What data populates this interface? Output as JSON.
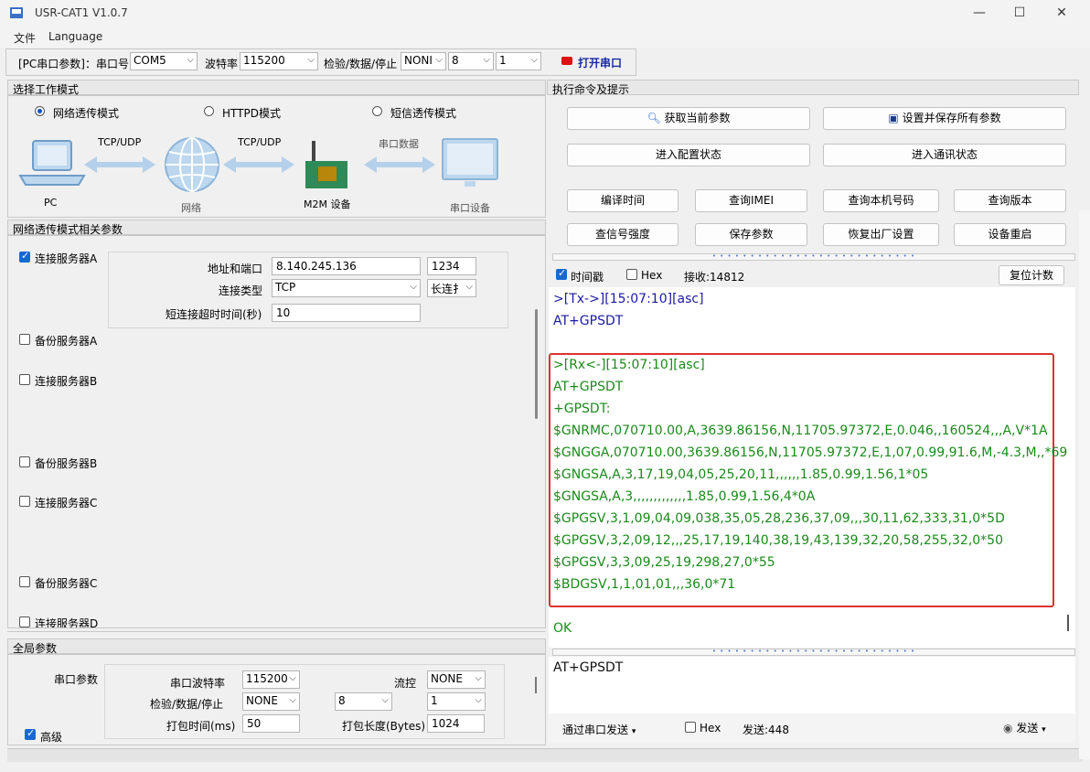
{
  "window": {
    "title": "USR-CAT1 V1.0.7",
    "min": "—",
    "max": "☐",
    "close": "✕"
  },
  "menu": {
    "file": "文件",
    "language": "Language"
  },
  "toolbar": {
    "pc_params": "[PC串口参数]：串口号",
    "port": "COM5",
    "baud_label": "波特率",
    "baud": "115200",
    "parity_label": "检验/数据/停止",
    "parity": "NONI",
    "data_bits": "8",
    "stop_bits": "1",
    "open_port": "打开串口"
  },
  "left": {
    "mode_header": "选择工作模式",
    "modes": [
      "网络透传模式",
      "HTTPD模式",
      "短信透传模式"
    ],
    "diagram": {
      "pc": "PC",
      "tcp1": "TCP/UDP",
      "network": "网络",
      "tcp2": "TCP/UDP",
      "m2m": "M2M 设备",
      "serial_data": "串口数据",
      "serial_device": "串口设备"
    },
    "params_header": "网络透传模式相关参数",
    "server_a": "连接服务器A",
    "addr_label": "地址和端口",
    "addr": "8.140.245.136",
    "port": "1234",
    "conn_type_label": "连接类型",
    "conn_type": "TCP",
    "long_conn": "长连扌",
    "timeout_label": "短连接超时时间(秒)",
    "timeout": "10",
    "backup_a": "备份服务器A",
    "server_b": "连接服务器B",
    "backup_b": "备份服务器B",
    "server_c": "连接服务器C",
    "backup_c": "备份服务器C",
    "server_d": "连接服务器D",
    "global_header": "全局参数",
    "serial_params": "串口参数",
    "baud_label": "串口波特率",
    "baud": "115200",
    "flow_label": "流控",
    "flow": "NONE",
    "parity_label": "检验/数据/停止",
    "parity": "NONE",
    "data_bits": "8",
    "stop_bits": "1",
    "pack_time_label": "打包时间(ms)",
    "pack_time": "50",
    "pack_len_label": "打包长度(Bytes)",
    "pack_len": "1024",
    "advanced": "高级"
  },
  "right": {
    "header": "执行命令及提示",
    "get_params": "获取当前参数",
    "save_params": "设置并保存所有参数",
    "enter_config": "进入配置状态",
    "enter_comm": "进入通讯状态",
    "buttons_row1": [
      "编译时间",
      "查询IMEI",
      "查询本机号码",
      "查询版本"
    ],
    "buttons_row2": [
      "查信号强度",
      "保存参数",
      "恢复出厂设置",
      "设备重启"
    ],
    "timestamp": "时间戳",
    "hex": "Hex",
    "recv": "接收:14812",
    "reset_count": "复位计数",
    "tx_lines": [
      ">[Tx->][15:07:10][asc]",
      "AT+GPSDT"
    ],
    "rx_lines": [
      ">[Rx<-][15:07:10][asc]",
      "AT+GPSDT",
      "+GPSDT:",
      "$GNRMC,070710.00,A,3639.86156,N,11705.97372,E,0.046,,160524,,,A,V*1A",
      "$GNGGA,070710.00,3639.86156,N,11705.97372,E,1,07,0.99,91.6,M,-4.3,M,,*69",
      "$GNGSA,A,3,17,19,04,05,25,20,11,,,,,,1.85,0.99,1.56,1*05",
      "$GNGSA,A,3,,,,,,,,,,,,,1.85,0.99,1.56,4*0A",
      "$GPGSV,3,1,09,04,09,038,35,05,28,236,37,09,,,30,11,62,333,31,0*5D",
      "$GPGSV,3,2,09,12,,,25,17,19,140,38,19,43,139,32,20,58,255,32,0*50",
      "$GPGSV,3,3,09,25,19,298,27,0*55",
      "$BDGSV,1,1,01,01,,,36,0*71"
    ],
    "ok": "OK",
    "send_text": "AT+GPSDT",
    "send_via": "通过串口发送",
    "send_hex": "Hex",
    "sent": "发送:448",
    "send": "发送"
  },
  "colors": {
    "tx": "#1a1aa0",
    "rx": "#1a8a1a",
    "highlight": "#e03030",
    "accent": "#1769d1"
  }
}
